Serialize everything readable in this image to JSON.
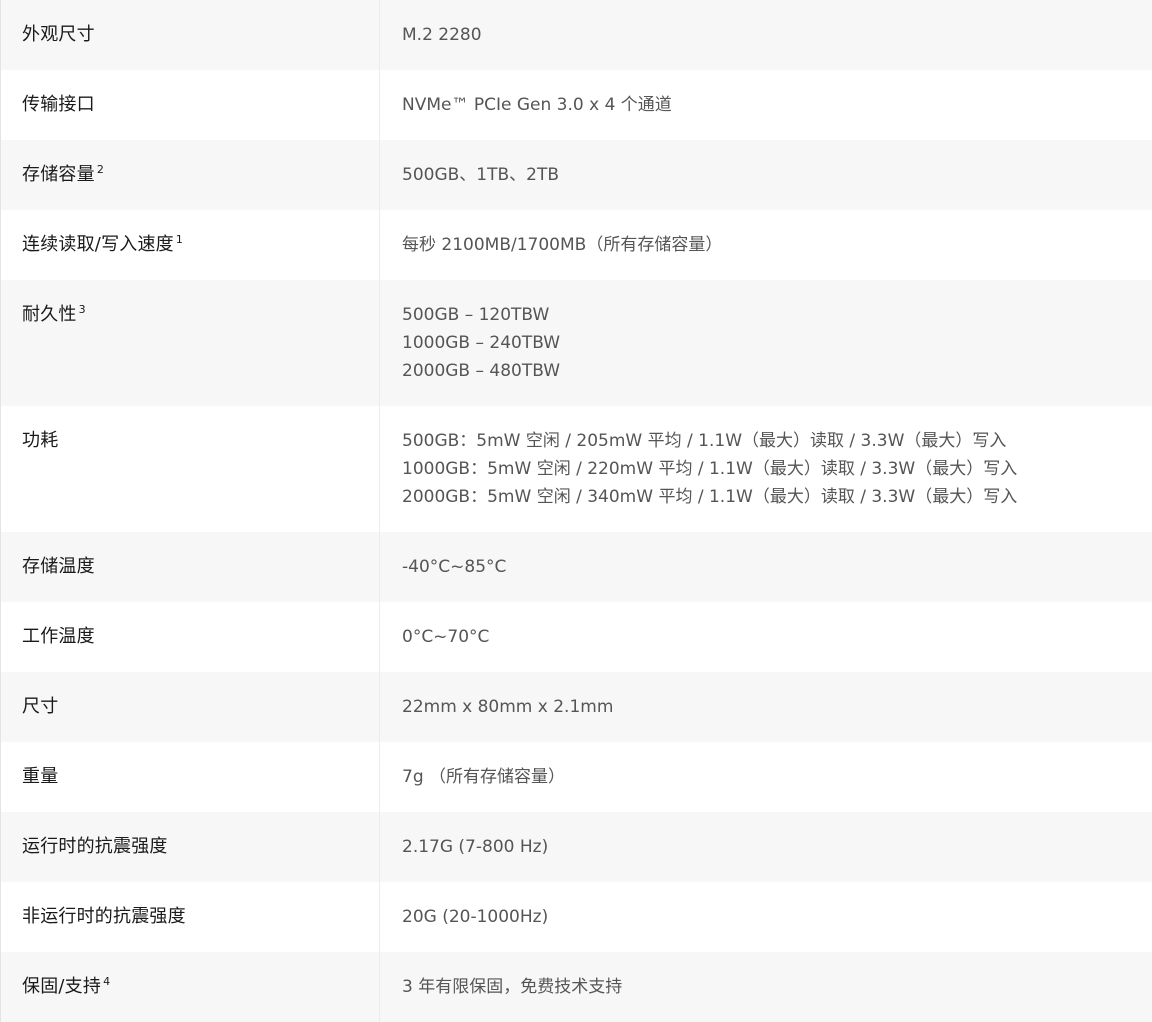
{
  "specs": [
    {
      "label": "外观尺寸",
      "sup": "",
      "values": [
        "M.2 2280"
      ]
    },
    {
      "label": "传输接口",
      "sup": "",
      "values": [
        "NVMe™ PCIe Gen 3.0 x 4 个通道"
      ]
    },
    {
      "label": "存储容量",
      "sup": "2",
      "values": [
        "500GB、1TB、2TB"
      ]
    },
    {
      "label": "连续读取/写入速度",
      "sup": "1",
      "values": [
        "每秒 2100MB/1700MB（所有存储容量）"
      ]
    },
    {
      "label": "耐久性",
      "sup": "3",
      "values": [
        "500GB – 120TBW",
        "1000GB – 240TBW",
        "2000GB – 480TBW"
      ]
    },
    {
      "label": "功耗",
      "sup": "",
      "values": [
        "500GB：5mW 空闲 / 205mW 平均 / 1.1W（最大）读取 / 3.3W（最大）写入",
        "1000GB：5mW 空闲 / 220mW 平均 / 1.1W（最大）读取 / 3.3W（最大）写入",
        "2000GB：5mW 空闲 / 340mW 平均 / 1.1W（最大）读取 / 3.3W（最大）写入"
      ]
    },
    {
      "label": "存储温度",
      "sup": "",
      "values": [
        "-40°C~85°C"
      ]
    },
    {
      "label": "工作温度",
      "sup": "",
      "values": [
        "0°C~70°C"
      ]
    },
    {
      "label": "尺寸",
      "sup": "",
      "values": [
        "22mm x 80mm x 2.1mm"
      ]
    },
    {
      "label": "重量",
      "sup": "",
      "values": [
        "7g （所有存储容量）"
      ]
    },
    {
      "label": "运行时的抗震强度",
      "sup": "",
      "values": [
        "2.17G (7-800 Hz)"
      ]
    },
    {
      "label": "非运行时的抗震强度",
      "sup": "",
      "values": [
        "20G (20-1000Hz)"
      ]
    },
    {
      "label": "保固/支持",
      "sup": "4",
      "values": [
        "3 年有限保固，免费技术支持"
      ]
    }
  ]
}
